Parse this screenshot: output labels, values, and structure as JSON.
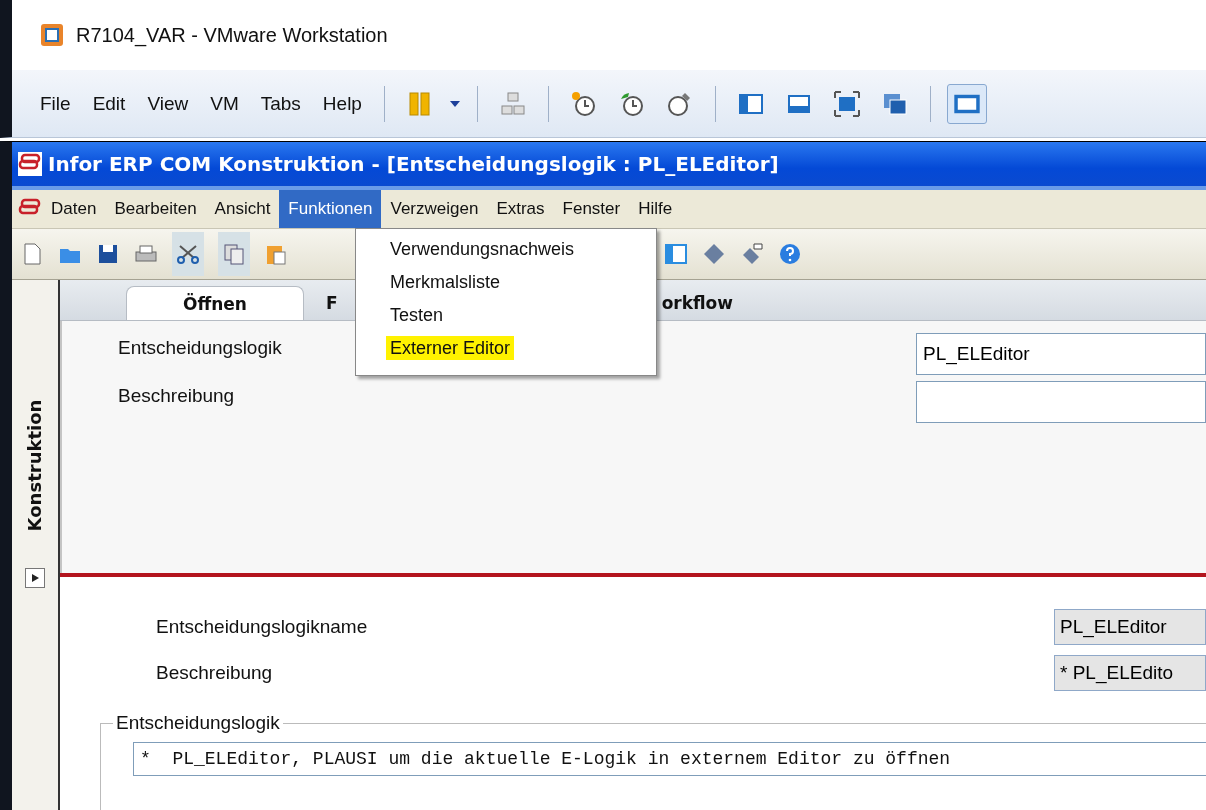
{
  "vm_window": {
    "title": "R7104_VAR - VMware Workstation"
  },
  "vm_menu": [
    "File",
    "Edit",
    "View",
    "VM",
    "Tabs",
    "Help"
  ],
  "app_window": {
    "title": "Infor ERP COM Konstruktion - [Entscheidungslogik : PL_ELEditor]"
  },
  "app_menu": [
    {
      "label": "Daten",
      "selected": false
    },
    {
      "label": "Bearbeiten",
      "selected": false
    },
    {
      "label": "Ansicht",
      "selected": false
    },
    {
      "label": "Funktionen",
      "selected": true
    },
    {
      "label": "Verzweigen",
      "selected": false
    },
    {
      "label": "Extras",
      "selected": false
    },
    {
      "label": "Fenster",
      "selected": false
    },
    {
      "label": "Hilfe",
      "selected": false
    }
  ],
  "open_menu": {
    "items": [
      {
        "label": "Verwendungsnachweis",
        "highlighted": false
      },
      {
        "label": "Merkmalsliste",
        "highlighted": false
      },
      {
        "label": "Testen",
        "highlighted": false
      },
      {
        "label": "Externer Editor",
        "highlighted": true
      }
    ]
  },
  "side_panel": {
    "label": "Konstruktion"
  },
  "tabs": [
    {
      "label": "Öffnen",
      "selected": true
    },
    {
      "label": "F",
      "selected": false
    },
    {
      "label": "orkflow",
      "selected": false
    }
  ],
  "search_form": {
    "fields": [
      {
        "label": "Entscheidungslogik",
        "value": "PL_ELEditor"
      },
      {
        "label": "Beschreibung"
      }
    ]
  },
  "detail_form": {
    "fields": [
      {
        "label": "Entscheidungslogikname",
        "value": "PL_ELEditor"
      },
      {
        "label": "Beschreibung",
        "value": "* PL_ELEdito"
      }
    ]
  },
  "logic_group": {
    "legend": "Entscheidungslogik",
    "code": "*  PL_ELEditor, PLAUSI um die aktuelle E-Logik in externem Editor zu öffnen"
  }
}
